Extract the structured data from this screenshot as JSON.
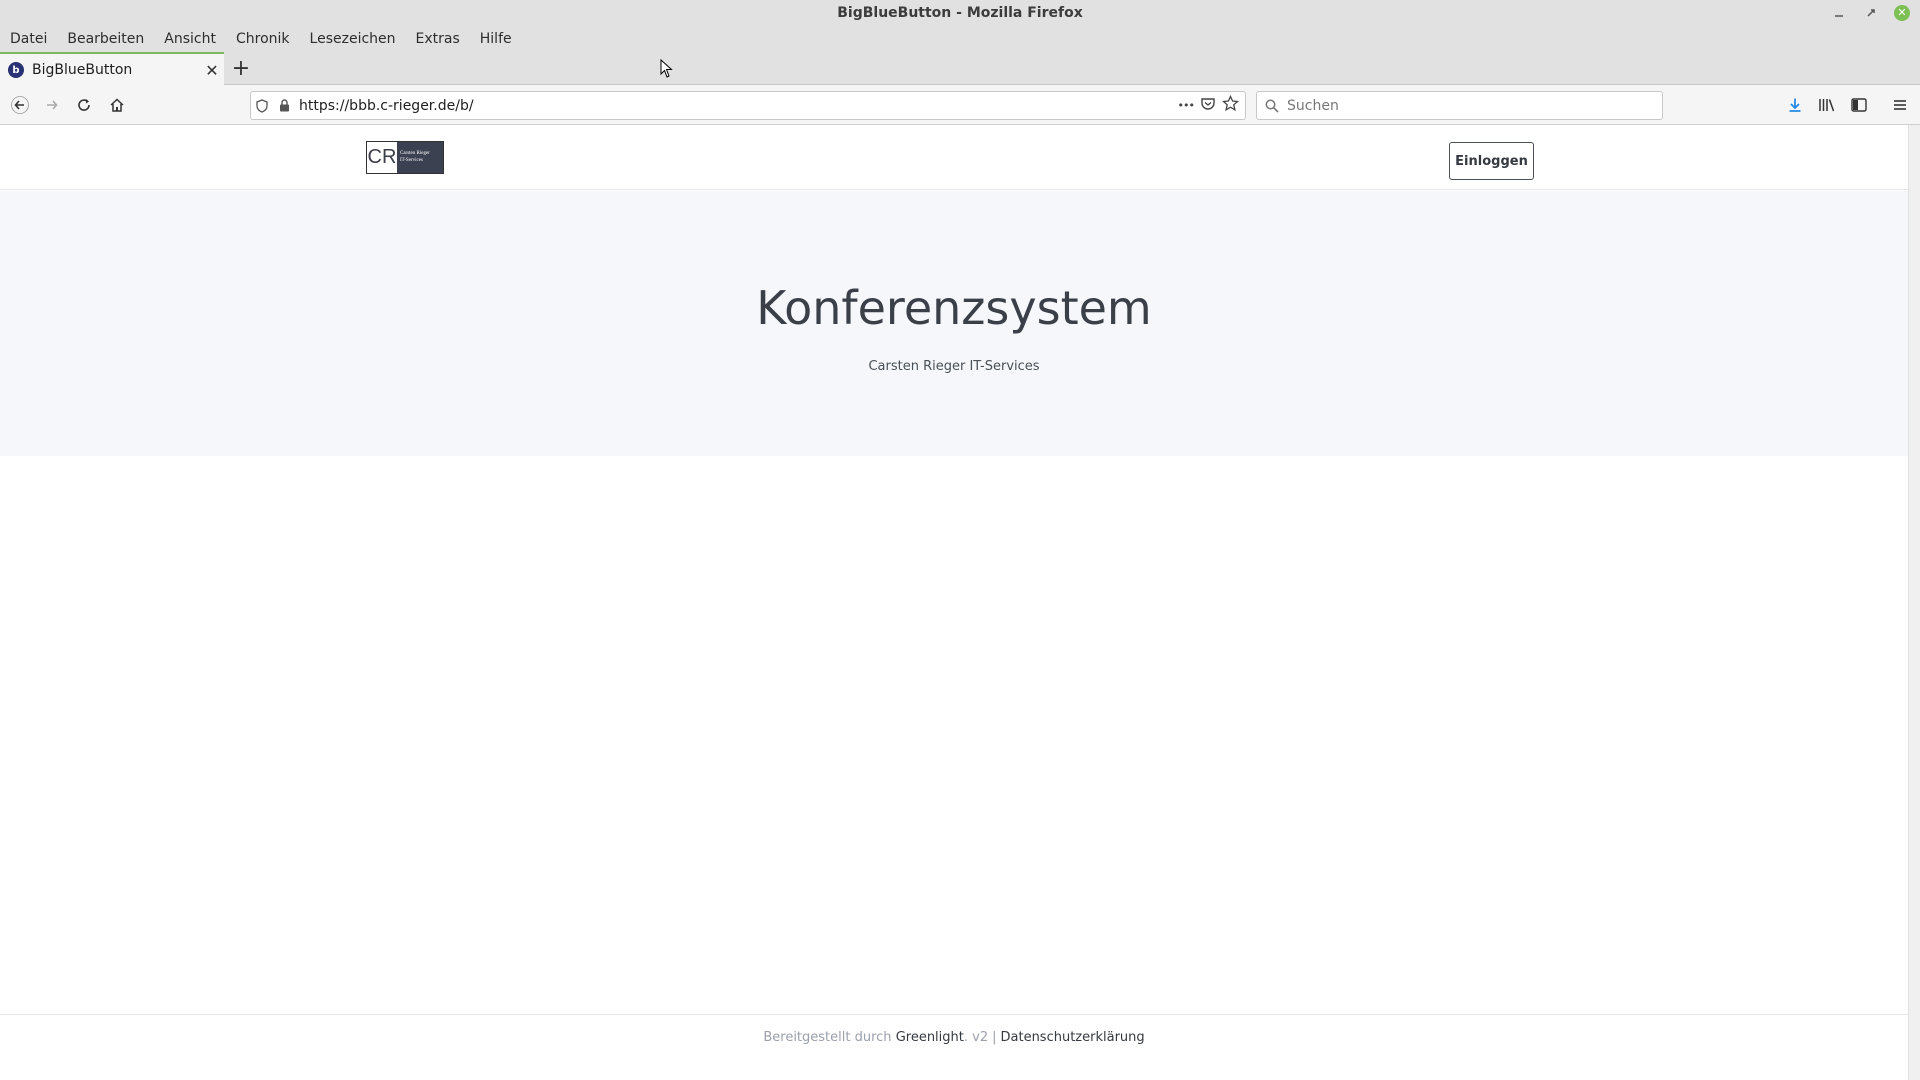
{
  "window": {
    "title": "BigBlueButton - Mozilla Firefox"
  },
  "menubar": {
    "items": [
      "Datei",
      "Bearbeiten",
      "Ansicht",
      "Chronik",
      "Lesezeichen",
      "Extras",
      "Hilfe"
    ]
  },
  "tab": {
    "title": "BigBlueButton",
    "favicon_letter": "b",
    "close_glyph": "✕",
    "new_tab_glyph": "+"
  },
  "navbar": {
    "url": "https://bbb.c-rieger.de/b/",
    "search_placeholder": "Suchen",
    "more_glyph": "•••"
  },
  "site": {
    "logo": {
      "initials": "CR",
      "line1": "Carsten Rieger",
      "line2": "IT-Services"
    },
    "login_label": "Einloggen",
    "hero_title": "Konferenzsystem",
    "hero_subtitle": "Carsten Rieger IT-Services",
    "footer": {
      "provided_by": "Bereitgestellt durch",
      "greenlight": "Greenlight",
      "version": ". v2",
      "divider": "|",
      "privacy": "Datenschutzerklärung"
    }
  },
  "colors": {
    "hero_bg": "#f5f7fb",
    "accent_green": "#7db85f",
    "download_blue": "#1e88e5"
  }
}
